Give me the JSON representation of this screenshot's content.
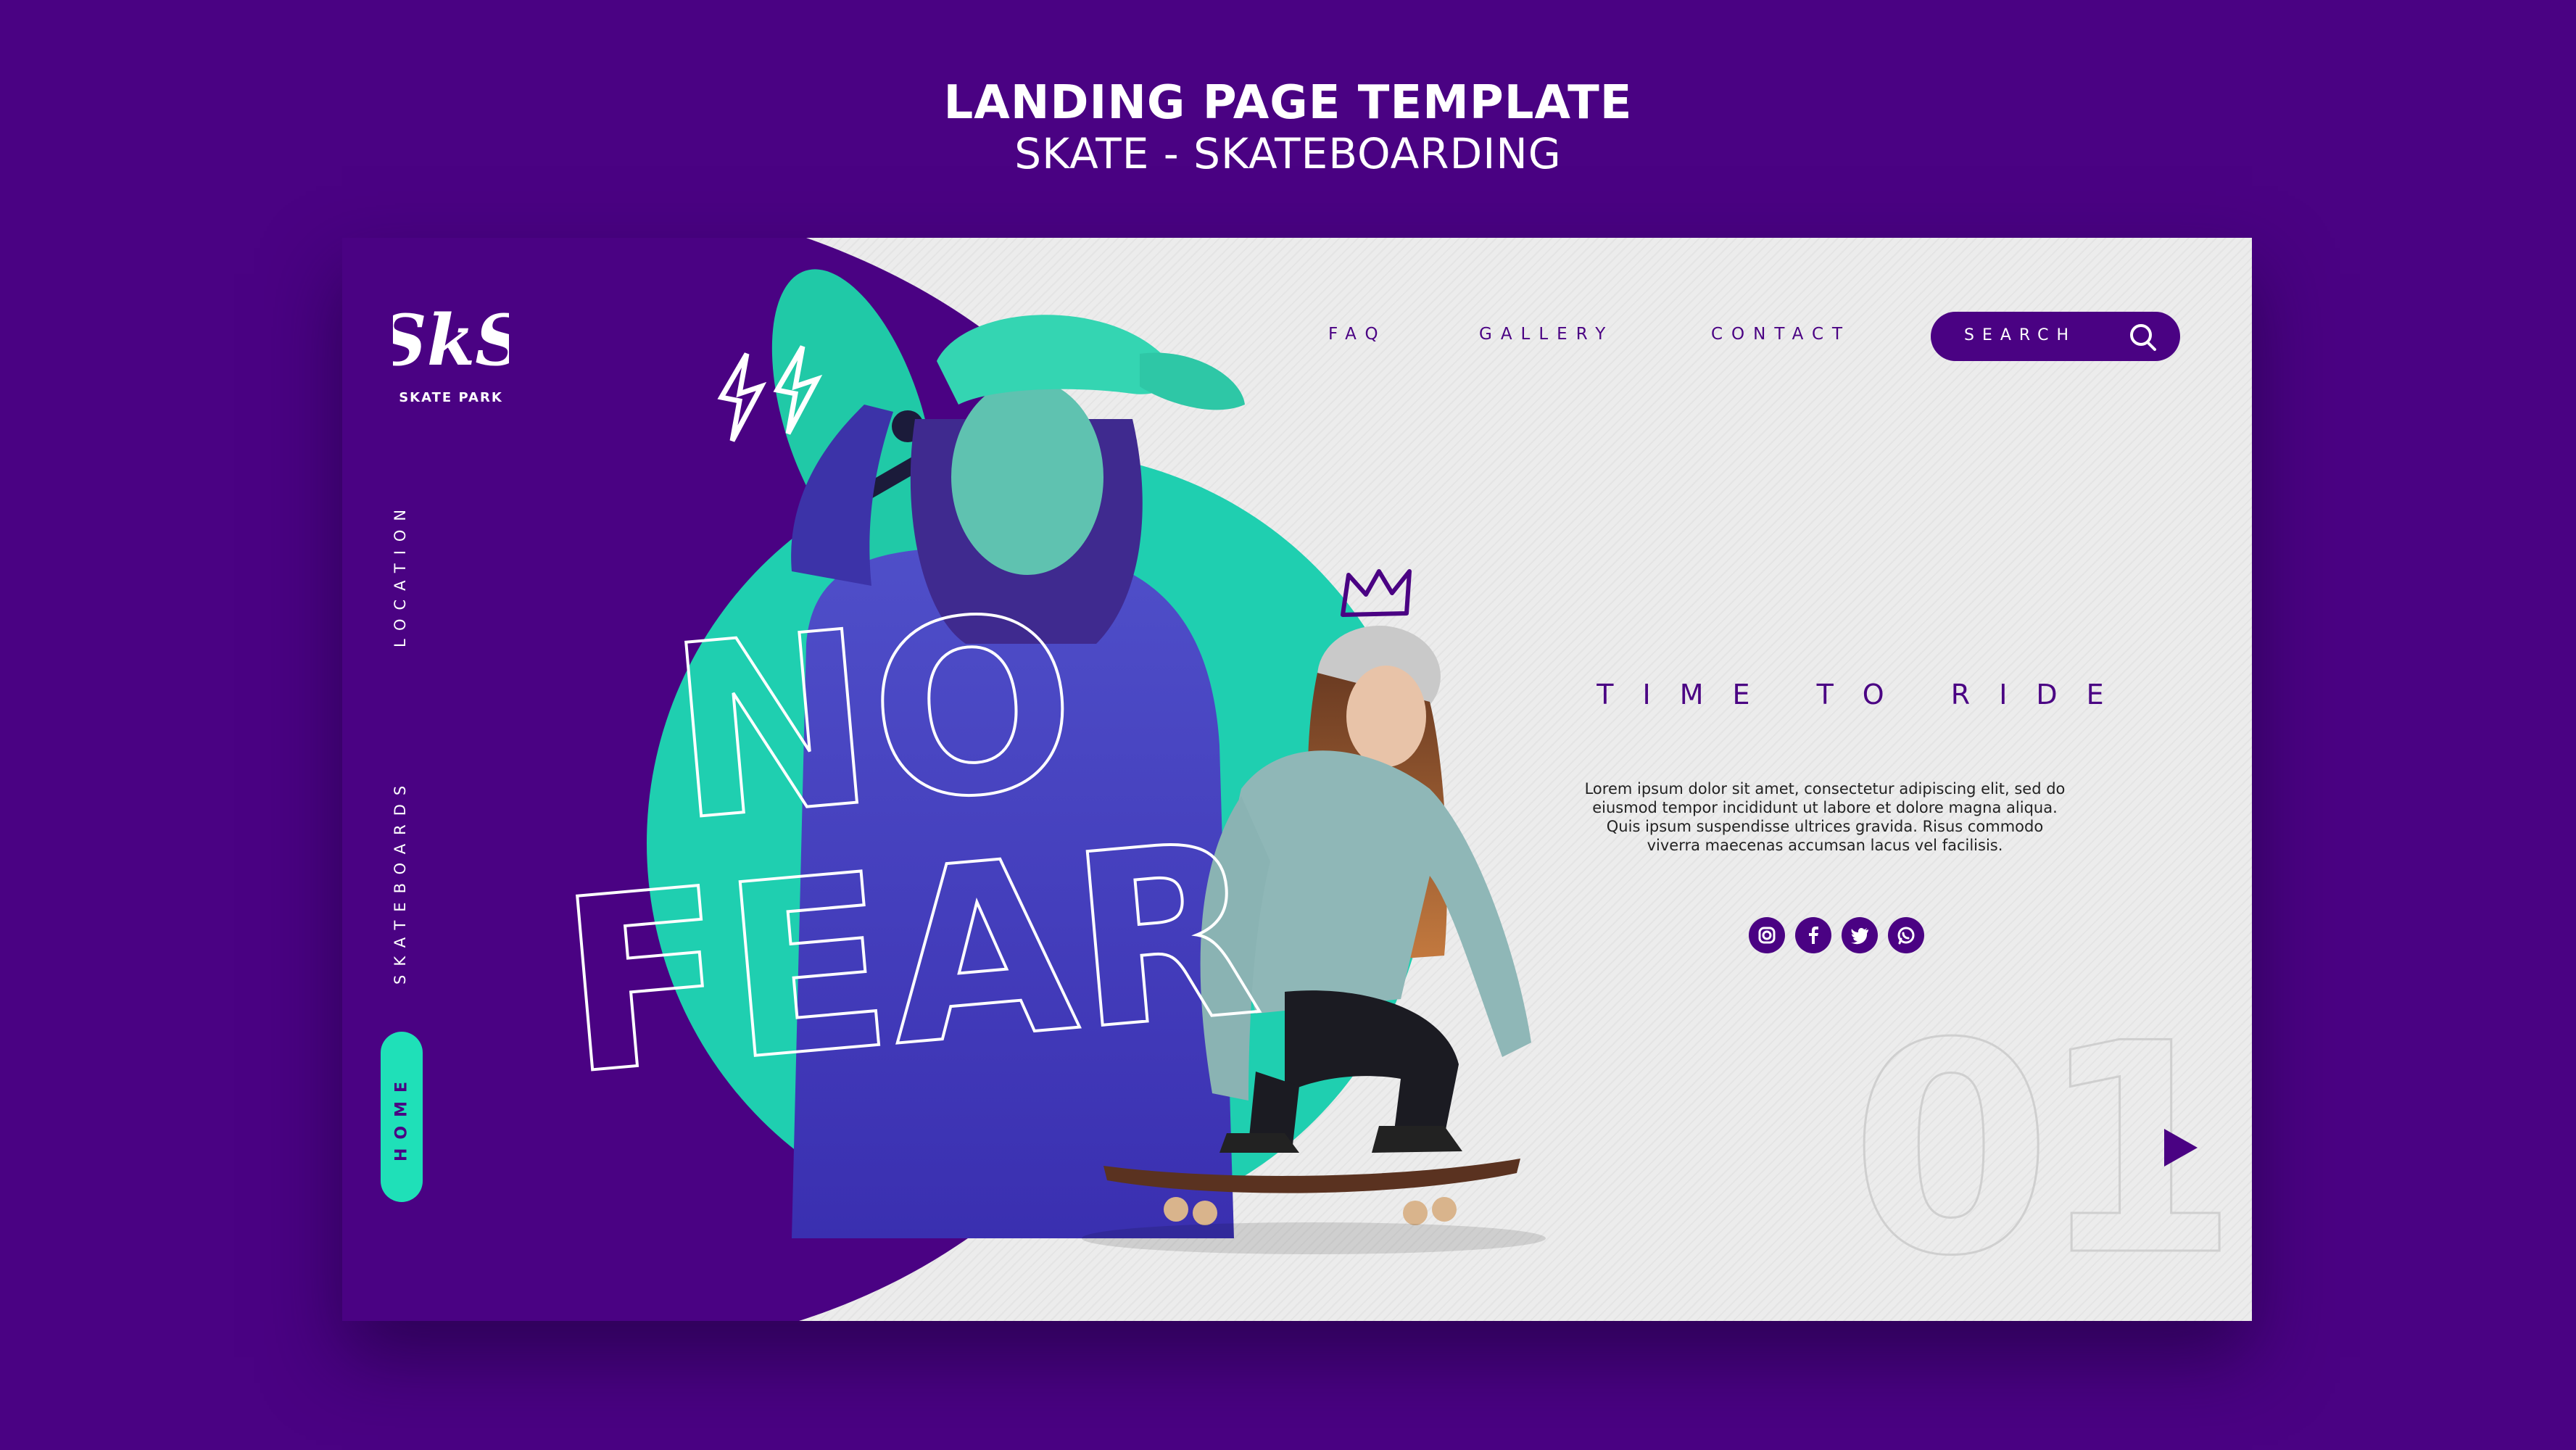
{
  "banner": {
    "title": "LANDING PAGE TEMPLATE",
    "subtitle": "SKATE - SKATEBOARDING"
  },
  "logo": {
    "mark": "SkS",
    "name": "SKATE PARK"
  },
  "side_nav": {
    "items": [
      "LOCATION",
      "SKATEBOARDS"
    ],
    "active": "HOME"
  },
  "top_nav": {
    "items": [
      "FAQ",
      "GALLERY",
      "CONTACT"
    ],
    "search_label": "SEARCH"
  },
  "hero": {
    "headline_line1": "NO",
    "headline_line2": "FEAR",
    "tagline": "TIME TO RIDE",
    "body": "Lorem ipsum dolor sit amet, consectetur adipiscing elit, sed do eiusmod tempor incididunt ut labore et dolore magna aliqua. Quis ipsum suspendisse ultrices gravida. Risus commodo viverra maecenas accumsan lacus vel facilisis.",
    "slide_number": "01"
  },
  "social_icons": [
    "instagram-icon",
    "facebook-icon",
    "twitter-icon",
    "whatsapp-icon"
  ],
  "colors": {
    "background": "#4a0283",
    "accent": "#1fe0b8",
    "panel": "#ececec",
    "text_dark": "#4a0283"
  }
}
